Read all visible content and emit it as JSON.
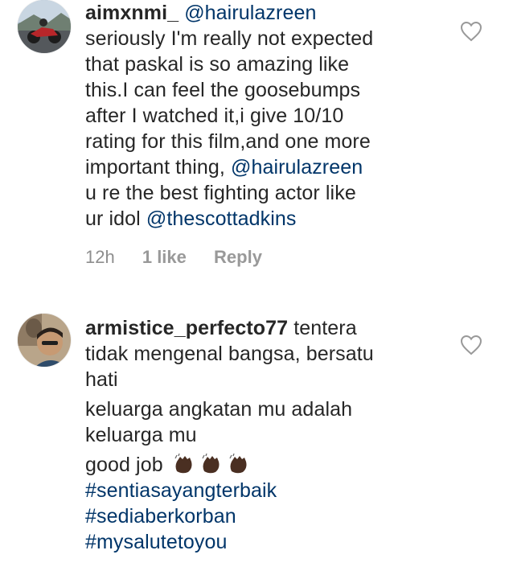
{
  "comments": [
    {
      "username": "aimxnmi_",
      "mention_reply": "@hairulazreen",
      "lines": [
        "seriously I'm really not expected",
        "that paskal is so amazing like",
        "this.I can feel the goosebumps",
        "after I watched it,i give 10/10",
        "rating for this film,and one more",
        "important thing,"
      ],
      "mention_inline": "@hairulazreen",
      "line_after_mention": "u re the best fighting actor like",
      "line_final_prefix": "ur idol",
      "mention_final": "@thescottadkins",
      "time": "12h",
      "likes": "1 like",
      "reply_label": "Reply",
      "avatar_icon": "profile-photo-motorcycle"
    },
    {
      "username": "armistice_perfecto77",
      "text_first": "tentera",
      "text_line2": "tidak mengenal bangsa, bersatu",
      "text_line3": "hati",
      "para2_line1": "keluarga angkatan mu adalah",
      "para2_line2": "keluarga mu",
      "para3_text": "good job",
      "emoji_icon": "clapping-hands-emoji",
      "hashtags": [
        "#sentiasayangterbaik",
        "#sediaberkorban",
        "#mysalutetoyou"
      ],
      "avatar_icon": "profile-photo-selfie"
    }
  ],
  "colors": {
    "text": "#262626",
    "link": "#003569",
    "meta": "#8e8e8e",
    "heart_stroke": "#999999"
  }
}
